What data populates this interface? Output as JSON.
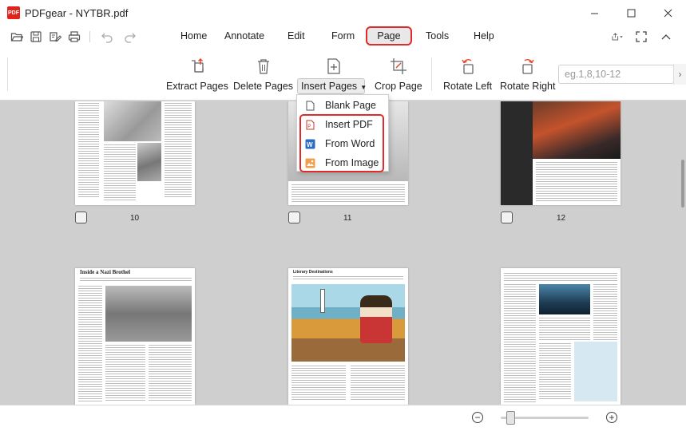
{
  "window": {
    "app_name": "PDFgear",
    "title": "PDFgear - NYTBR.pdf",
    "logo_text": "PDF"
  },
  "quick_access": [
    "open-icon",
    "save-icon",
    "edit-icon",
    "print-icon",
    "undo-icon",
    "redo-icon"
  ],
  "menu": {
    "items": [
      "Home",
      "Annotate",
      "Edit",
      "Form",
      "Page",
      "Tools",
      "Help"
    ],
    "active": "Page"
  },
  "ribbon": {
    "extract": "Extract Pages",
    "delete": "Delete Pages",
    "insert": "Insert Pages",
    "crop": "Crop Page",
    "rotate_left": "Rotate Left",
    "rotate_right": "Rotate Right",
    "page_range_placeholder": "eg.1,8,10-12"
  },
  "insert_menu": {
    "items": [
      "Blank Page",
      "Insert PDF",
      "From Word",
      "From Image"
    ],
    "highlighted_items": [
      "Insert PDF",
      "From Word",
      "From Image"
    ]
  },
  "pages": {
    "row1": [
      "10",
      "11",
      "12"
    ],
    "row2_headings": [
      "Inside a Nazi Brothel",
      "Literary Destinations"
    ]
  },
  "colors": {
    "accent_red": "#e02b2b",
    "word_blue": "#2b6cc4",
    "image_orange": "#f0a04b"
  }
}
